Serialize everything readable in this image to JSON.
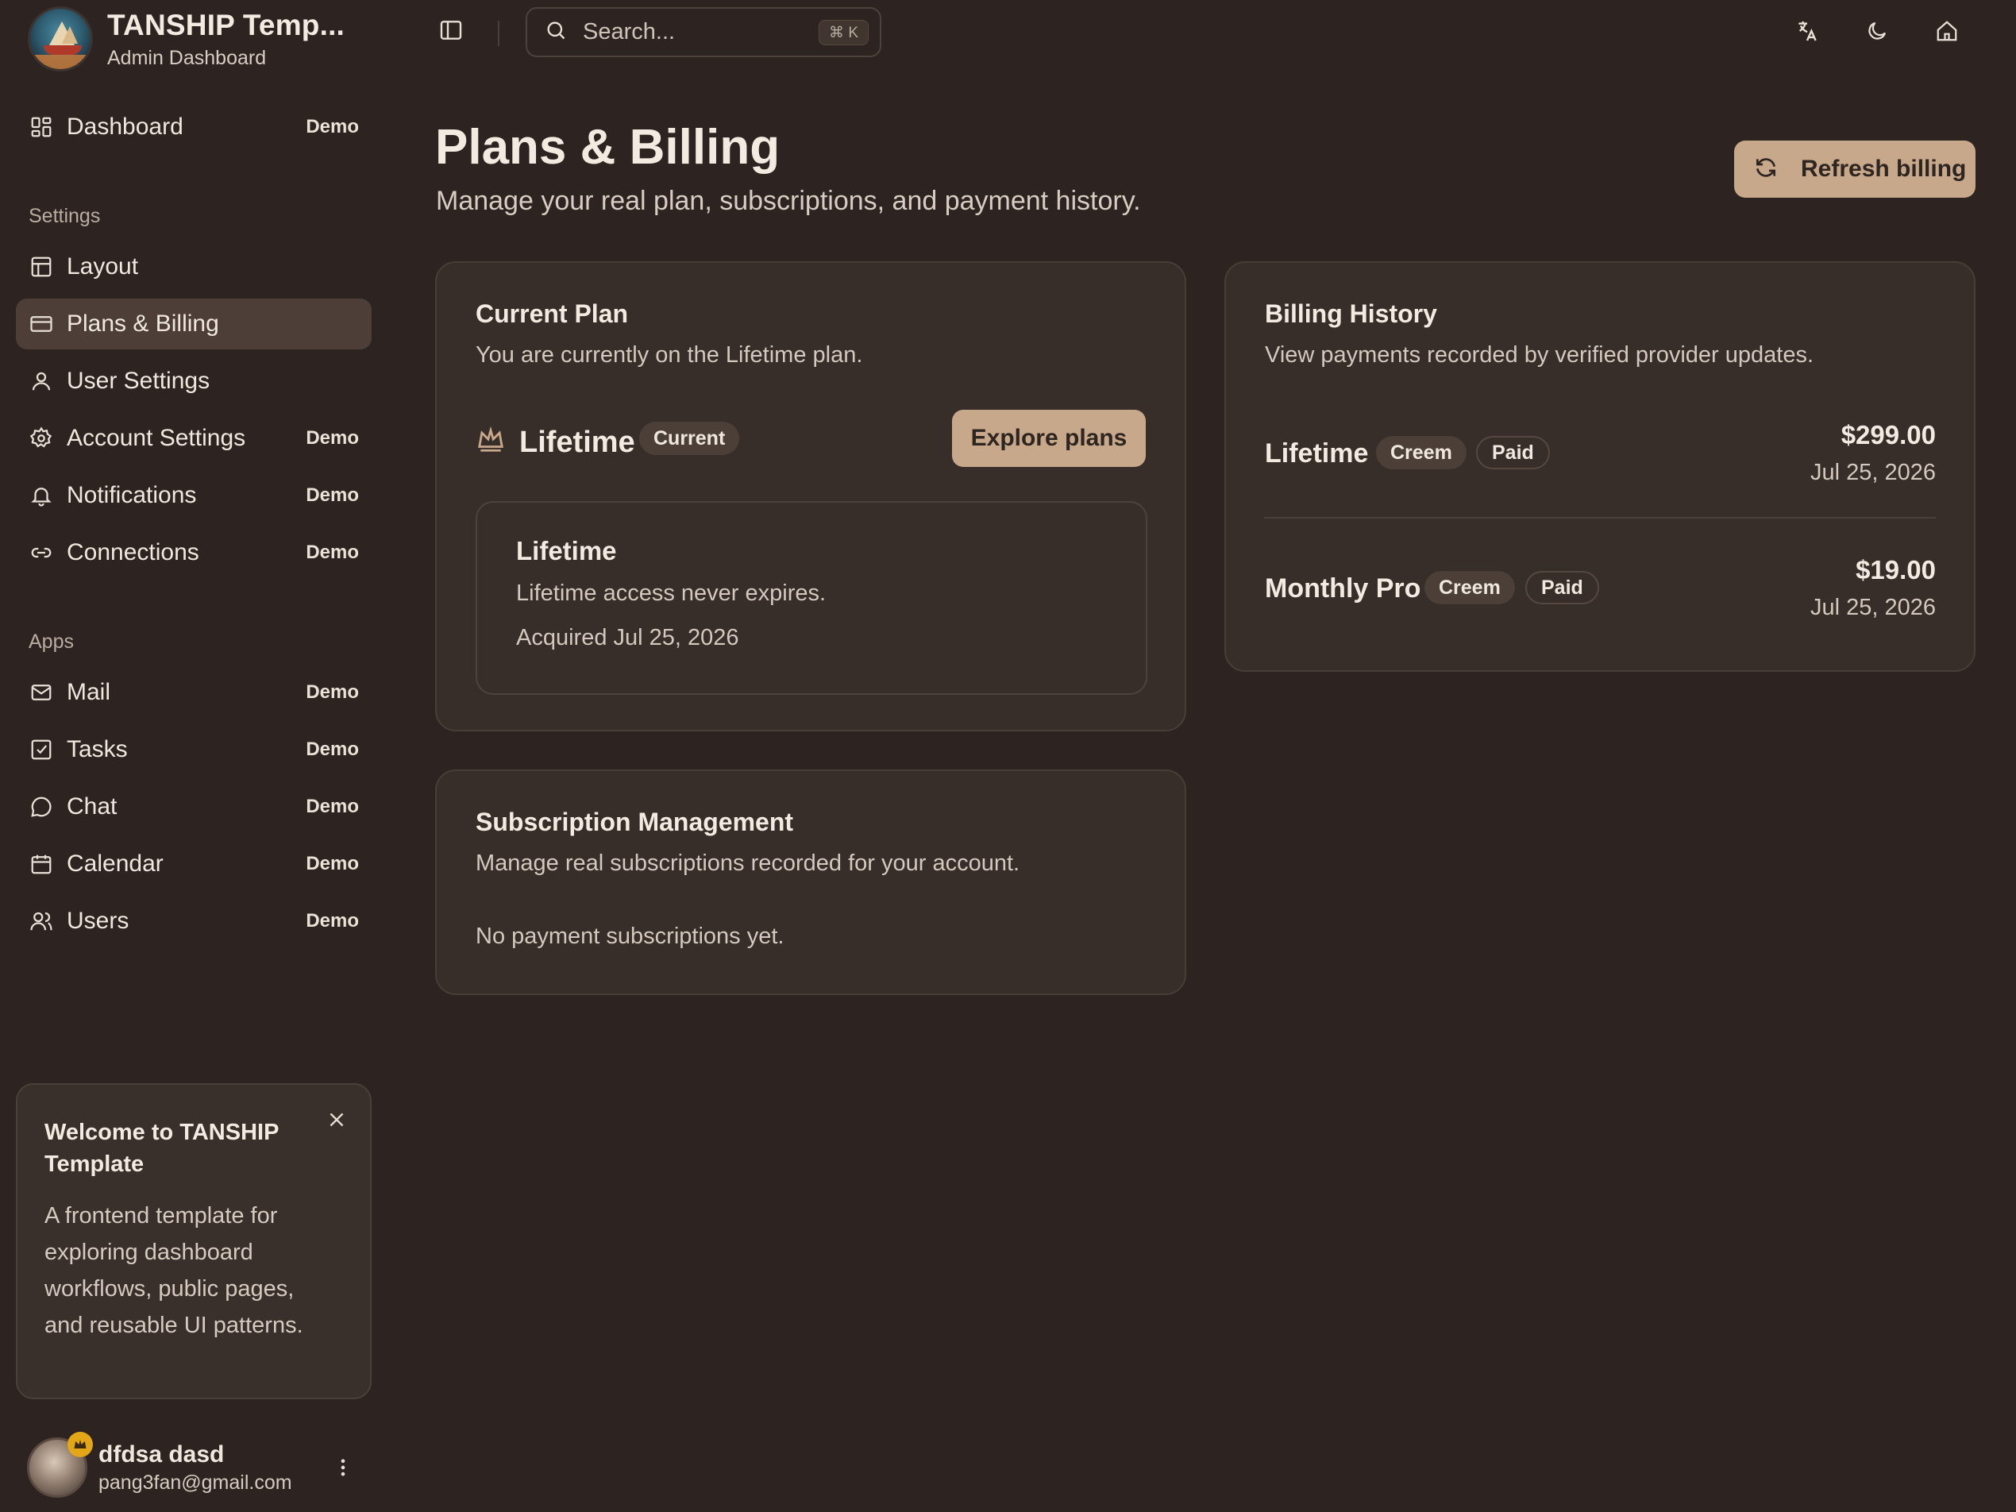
{
  "brand": {
    "title": "TANSHIP Temp...",
    "subtitle": "Admin Dashboard"
  },
  "topbar": {
    "search_placeholder": "Search...",
    "search_shortcut": "⌘ K"
  },
  "sidebar": {
    "dashboard": {
      "label": "Dashboard",
      "badge": "Demo"
    },
    "settings_section": "Settings",
    "settings_items": [
      {
        "label": "Layout",
        "badge": ""
      },
      {
        "label": "Plans & Billing",
        "badge": ""
      },
      {
        "label": "User Settings",
        "badge": ""
      },
      {
        "label": "Account Settings",
        "badge": "Demo"
      },
      {
        "label": "Notifications",
        "badge": "Demo"
      },
      {
        "label": "Connections",
        "badge": "Demo"
      }
    ],
    "apps_section": "Apps",
    "apps_items": [
      {
        "label": "Mail",
        "badge": "Demo"
      },
      {
        "label": "Tasks",
        "badge": "Demo"
      },
      {
        "label": "Chat",
        "badge": "Demo"
      },
      {
        "label": "Calendar",
        "badge": "Demo"
      },
      {
        "label": "Users",
        "badge": "Demo"
      }
    ],
    "active_item": "Plans & Billing"
  },
  "welcome": {
    "title": "Welcome to TANSHIP Template",
    "body": "A frontend template for exploring dashboard workflows, public pages, and reusable UI patterns."
  },
  "user": {
    "name": "dfdsa dasd",
    "email": "pang3fan@gmail.com"
  },
  "page": {
    "title": "Plans & Billing",
    "subtitle": "Manage your real plan, subscriptions, and payment history.",
    "refresh_label": "Refresh billing"
  },
  "current_plan": {
    "title": "Current Plan",
    "description": "You are currently on the Lifetime plan.",
    "plan_name": "Lifetime",
    "plan_badge": "Current",
    "explore_label": "Explore plans",
    "detail_title": "Lifetime",
    "detail_line1": "Lifetime access never expires.",
    "detail_line2": "Acquired Jul 25, 2026"
  },
  "subscription_management": {
    "title": "Subscription Management",
    "description": "Manage real subscriptions recorded for your account.",
    "empty_text": "No payment subscriptions yet."
  },
  "billing_history": {
    "title": "Billing History",
    "description": "View payments recorded by verified provider updates.",
    "entries": [
      {
        "name": "Lifetime",
        "provider": "Creem",
        "status": "Paid",
        "amount": "$299.00",
        "date": "Jul 25, 2026"
      },
      {
        "name": "Monthly Pro",
        "provider": "Creem",
        "status": "Paid",
        "amount": "$19.00",
        "date": "Jul 25, 2026"
      }
    ]
  },
  "colors": {
    "background": "#2d2421",
    "card": "#372d29",
    "accent": "#c8a88b",
    "active_nav": "#4d3f37",
    "crown_badge": "#e2a617"
  }
}
